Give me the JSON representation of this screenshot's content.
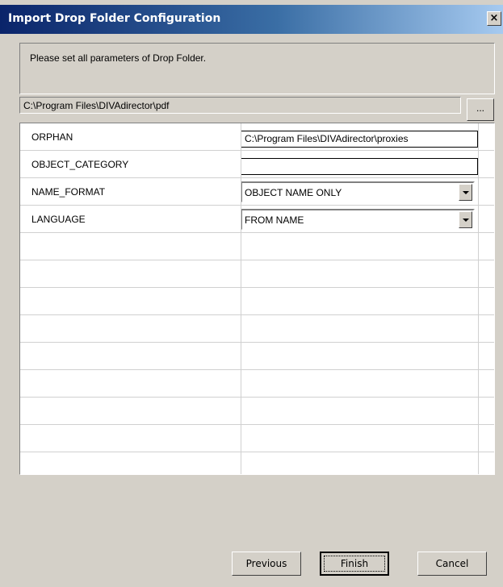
{
  "dialog": {
    "title": "Import Drop Folder Configuration",
    "close_glyph": "×",
    "instruction": "Please set all parameters of Drop Folder.",
    "folder_path": "C:\\Program Files\\DIVAdirector\\pdf",
    "browse_label": "..."
  },
  "parameters": {
    "rows": [
      {
        "name": "ORPHAN",
        "value": "C:\\Program Files\\DIVAdirector\\proxies",
        "control": "text"
      },
      {
        "name": "OBJECT_CATEGORY",
        "value": "",
        "control": "text"
      },
      {
        "name": "NAME_FORMAT",
        "value": "OBJECT NAME ONLY",
        "control": "dropdown"
      },
      {
        "name": "LANGUAGE",
        "value": "FROM NAME",
        "control": "dropdown"
      }
    ],
    "empty_row_count": 8
  },
  "buttons": {
    "previous": "Previous",
    "finish": "Finish",
    "cancel": "Cancel"
  },
  "icons": {
    "close": "close-icon",
    "dropdown": "chevron-down-icon"
  }
}
